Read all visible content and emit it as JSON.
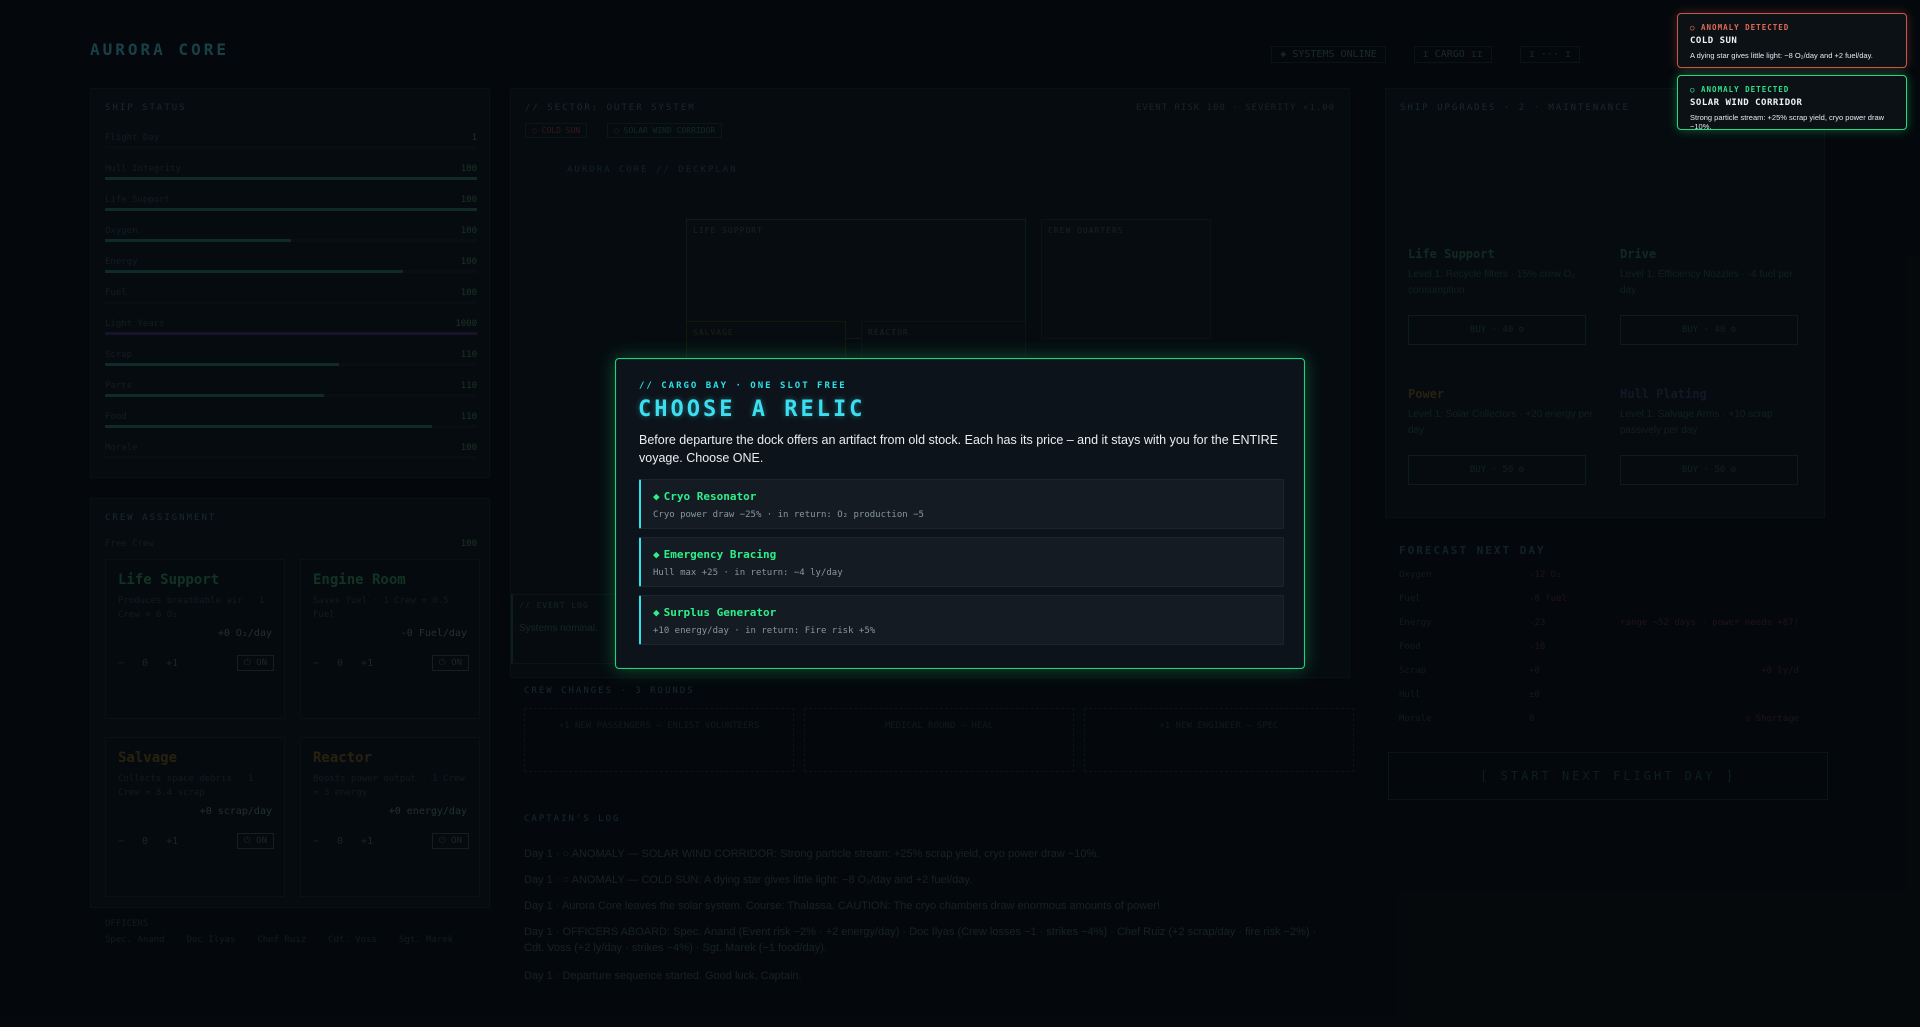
{
  "app": {
    "brand": "AURORA CORE",
    "status": [
      "◈ SYSTEMS ONLINE",
      "ɪ CARGO ɪɪ",
      "ɪ ··· ɪ"
    ]
  },
  "ship_status": {
    "title": "SHIP STATUS",
    "rows": [
      {
        "label": "Flight Day",
        "value": "1",
        "fill": 0
      },
      {
        "label": "Hull Integrity",
        "value": "100",
        "fill": 1.0
      },
      {
        "label": "Life Support",
        "value": "100",
        "fill": 1.0
      },
      {
        "label": "Oxygen",
        "value": "100",
        "fill": 0.5
      },
      {
        "label": "Energy",
        "value": "100",
        "fill": 0.8
      },
      {
        "label": "Fuel",
        "value": "100",
        "fill": 0
      },
      {
        "label": "Light Years",
        "value": "1000",
        "fill": 1.0
      },
      {
        "label": "Scrap",
        "value": "110",
        "fill": 0.63
      },
      {
        "label": "Parts",
        "value": "110",
        "fill": 0.59
      },
      {
        "label": "Food",
        "value": "110",
        "fill": 0.88
      },
      {
        "label": "Morale",
        "value": "100",
        "fill": 0
      }
    ]
  },
  "crew_assignment": {
    "title": "CREW ASSIGNMENT",
    "free_label": "Free Crew",
    "free_value": "100",
    "modules": [
      {
        "name": "Life Support",
        "desc": "Produces breathable air · 1 Crew = 6 O₂",
        "rate": "+0 O₂/day",
        "count": "0",
        "plus": "+1",
        "on": "⏻ ON"
      },
      {
        "name": "Engine Room",
        "desc": "Saves fuel · 1 Crew = 0.5 Fuel",
        "rate": "-0 Fuel/day",
        "count": "0",
        "plus": "+1",
        "on": "⏻ ON"
      },
      {
        "name": "Salvage",
        "desc": "Collects space debris · 1 Crew = 8.4 scrap",
        "rate": "+0 scrap/day",
        "count": "0",
        "plus": "+1",
        "on": "⏻ ON"
      },
      {
        "name": "Reactor",
        "desc": "Boosts power output · 1 Crew = 3 energy",
        "rate": "+0 energy/day",
        "count": "0",
        "plus": "+1",
        "on": "⏻ ON"
      }
    ],
    "officers_label": "OFFICERS",
    "officers": [
      "Spec. Anand",
      "Doc Ilyas",
      "Chef Ruiz",
      "Cdt. Voss",
      "Sgt. Marek"
    ]
  },
  "sector": {
    "title": "// SECTOR: OUTER SYSTEM",
    "severity": "EVENT RISK 100 · SEVERITY ×1.00",
    "tags": [
      "○ COLD SUN",
      "○ SOLAR WIND CORRIDOR"
    ],
    "ship_title": "AURORA CORE // DECKPLAN",
    "rooms": [
      "LIFE SUPPORT",
      "CREW QUARTERS",
      "SALVAGE",
      "REACTOR"
    ],
    "event_title": "// EVENT LOG",
    "event_text": "Systems nominal."
  },
  "crew_changes": {
    "title": "CREW CHANGES · 3 ROUNDS",
    "cards": [
      "+1 NEW PASSENGERS — ENLIST VOLUNTEERS",
      "MEDICAL ROUND — HEAL",
      "+1 NEW ENGINEER — SPEC"
    ]
  },
  "captain_log": {
    "title": "CAPTAIN'S LOG",
    "lines": [
      "Day 1 · ○ ANOMALY — SOLAR WIND CORRIDOR: Strong particle stream: +25% scrap yield, cryo power draw −10%.",
      "Day 1 · ○ ANOMALY — COLD SUN: A dying star gives little light: −8 O₂/day and +2 fuel/day.",
      "Day 1 · Aurora Core leaves the solar system. Course: Thalassa. CAUTION: The cryo chambers draw enormous amounts of power!",
      "Day 1 · OFFICERS ABOARD: Spec. Anand (Event risk −2% · +2 energy/day) · Doc Ilyas (Crew losses −1 · strikes −4%) · Chef Ruiz (+2 scrap/day · fire risk −2%) · Cdt. Voss (+2 ly/day · strikes −4%) · Sgt. Marek (−1 food/day).",
      "Day 1 · Departure sequence started. Good luck, Captain."
    ]
  },
  "upgrades": {
    "title": "SHIP UPGRADES · 2 · MAINTENANCE",
    "cards": [
      {
        "name": "Life Support",
        "desc": "Level 1: Recycle filters · 15% crew O₂ consumption",
        "btn": "BUY · 40 ⚙"
      },
      {
        "name": "Drive",
        "desc": "Level 1: Efficiency Nozzles · -4 fuel per day",
        "btn": "BUY · 40 ⚙"
      },
      {
        "name": "Power",
        "desc": "Level 1: Solar Collectors · +20 energy per day",
        "btn": "BUY · 50 ⚙"
      },
      {
        "name": "Hull Plating",
        "desc": "Level 1: Salvage Arms · +10 scrap passively per day",
        "btn": "BUY · 50 ⚙"
      }
    ]
  },
  "forecast": {
    "title": "FORECAST NEXT DAY",
    "rows": [
      {
        "label": "Oxygen",
        "value": "-12 O₂"
      },
      {
        "label": "Fuel",
        "value": "-8 fuel"
      },
      {
        "label": "Energy",
        "value": "-23",
        "note": "range ~52 days · power needs +87!"
      },
      {
        "label": "Food",
        "value": "-10"
      },
      {
        "label": "Scrap",
        "value": "+0",
        "note": "+0 ly/d"
      },
      {
        "label": "Hull",
        "value": "±0"
      },
      {
        "label": "Morale",
        "value": "0",
        "note": "◇ Shortage"
      }
    ]
  },
  "start_button": "[ START NEXT FLIGHT DAY ]",
  "modal": {
    "eyebrow": "// CARGO BAY · ONE SLOT FREE",
    "title": "CHOOSE A RELIC",
    "desc": "Before departure the dock offers an artifact from old stock. Each has its price – and it stays with you for the ENTIRE voyage. Choose ONE.",
    "relics": [
      {
        "name": "Cryo Resonator",
        "desc": "Cryo power draw −25% · in return: O₂ production −5"
      },
      {
        "name": "Emergency Bracing",
        "desc": "Hull max +25 · in return: −4 ly/day"
      },
      {
        "name": "Surplus Generator",
        "desc": "+10 energy/day · in return: Fire risk +5%"
      }
    ]
  },
  "toasts": [
    {
      "label": "○ ANOMALY DETECTED",
      "title": "COLD SUN",
      "desc": "A dying star gives little light: −8 O₂/day and +2 fuel/day."
    },
    {
      "label": "○ ANOMALY DETECTED",
      "title": "SOLAR WIND CORRIDOR",
      "desc": "Strong particle stream: +25% scrap yield, cryo power draw −10%."
    }
  ],
  "colors": {
    "accent": "#1fd47e",
    "title": "#3cdff0",
    "danger": "#c8564a"
  }
}
